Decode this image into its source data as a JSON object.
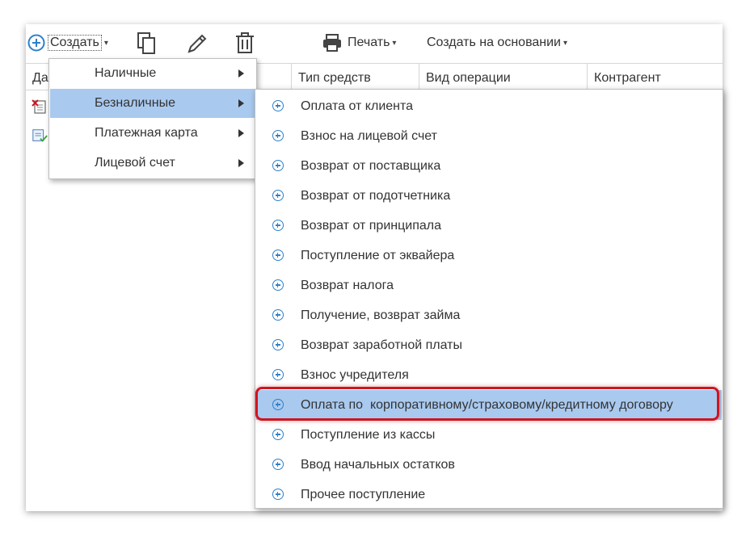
{
  "toolbar": {
    "create_label": "Создать",
    "copy_icon": "copy-icon",
    "edit_icon": "pencil-icon",
    "delete_icon": "trash-icon",
    "print_label": "Печать",
    "based_on_label": "Создать на основании",
    "accent_color": "#2f7fc8"
  },
  "table": {
    "headers": [
      "Да",
      "Тип средств",
      "Вид операции",
      "Контрагент"
    ]
  },
  "menu1": {
    "items": [
      {
        "label": "Наличные",
        "active": false
      },
      {
        "label": "Безналичные",
        "active": true
      },
      {
        "label": "Платежная карта",
        "active": false
      },
      {
        "label": "Лицевой счет",
        "active": false
      }
    ]
  },
  "menu2": {
    "items": [
      {
        "label": "Оплата от клиента"
      },
      {
        "label": "Взнос на лицевой счет"
      },
      {
        "label": "Возврат от поставщика"
      },
      {
        "label": "Возврат от подотчетника"
      },
      {
        "label": "Возврат от принципала"
      },
      {
        "label": "Поступление от эквайера"
      },
      {
        "label": "Возврат налога"
      },
      {
        "label": "Получение, возврат займа"
      },
      {
        "label": "Возврат заработной платы"
      },
      {
        "label": "Взнос учредителя"
      },
      {
        "label": "Оплата по  корпоративному/страховому/кредитному договору",
        "highlighted": true
      },
      {
        "label": "Поступление из кассы"
      },
      {
        "label": "Ввод начальных остатков"
      },
      {
        "label": "Прочее поступление"
      }
    ],
    "highlight_color": "#a9c9ef",
    "annotation_color": "#d0141e"
  }
}
